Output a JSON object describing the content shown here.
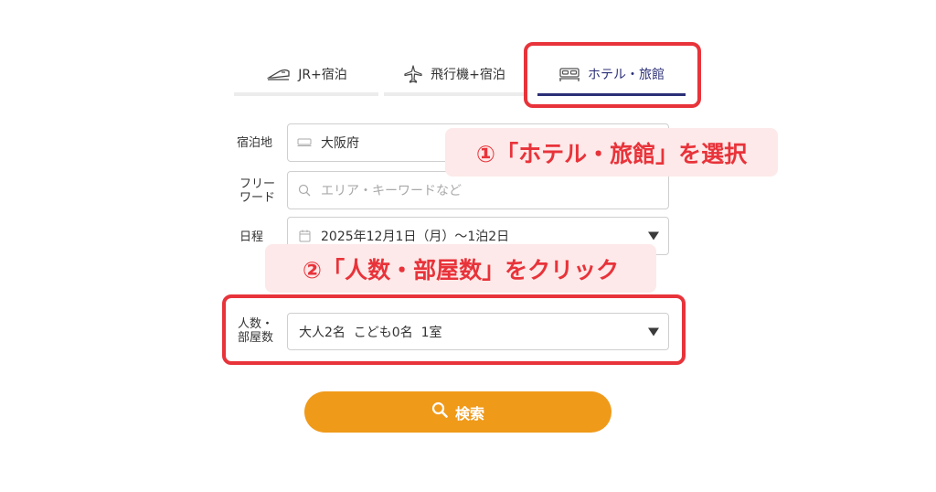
{
  "tabs": [
    {
      "label": "JR+宿泊",
      "icon": "train-icon"
    },
    {
      "label": "飛行機+宿泊",
      "icon": "airplane-icon"
    },
    {
      "label": "ホテル・旅館",
      "icon": "bed-icon",
      "active": true
    }
  ],
  "form": {
    "destination": {
      "label": "宿泊地",
      "value": "大阪府"
    },
    "keyword": {
      "label_line1": "フリー",
      "label_line2": "ワード",
      "placeholder": "エリア・キーワードなど"
    },
    "date": {
      "label": "日程",
      "value": "2025年12月1日（月）〜1泊2日"
    },
    "guests": {
      "label_line1": "人数・",
      "label_line2": "部屋数",
      "value": "大人2名  こども0名  1室"
    }
  },
  "search_button": {
    "label": "検索"
  },
  "annotations": {
    "step1": "①「ホテル・旅館」を選択",
    "step2": "②「人数・部屋数」をクリック"
  },
  "colors": {
    "accent_navy": "#2b2f77",
    "highlight_red": "#e8333a",
    "callout_bg": "#fde9e9",
    "button_orange": "#f09a1a"
  }
}
